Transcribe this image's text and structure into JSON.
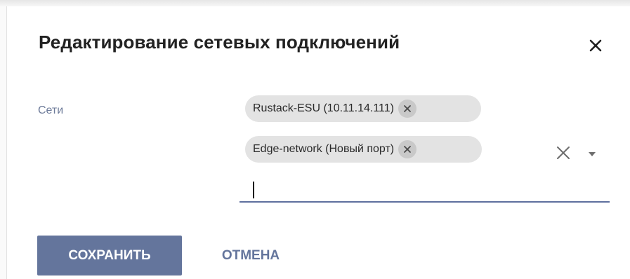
{
  "dialog": {
    "title": "Редактирование сетевых подключений",
    "close_icon": "close-icon"
  },
  "networks_field": {
    "label": "Сети",
    "chips": [
      {
        "label": "Rustack-ESU (10.11.14.111)",
        "remove_icon": "close-small-icon"
      },
      {
        "label": "Edge-network (Новый порт)",
        "remove_icon": "close-small-icon"
      }
    ],
    "input_value": "",
    "clear_icon": "clear-icon",
    "dropdown_icon": "caret-down-icon"
  },
  "actions": {
    "save_label": "СОХРАНИТЬ",
    "cancel_label": "ОТМЕНА"
  },
  "colors": {
    "accent": "#64759c",
    "chip_bg": "#e3e3e3",
    "label": "#6c7a99"
  }
}
